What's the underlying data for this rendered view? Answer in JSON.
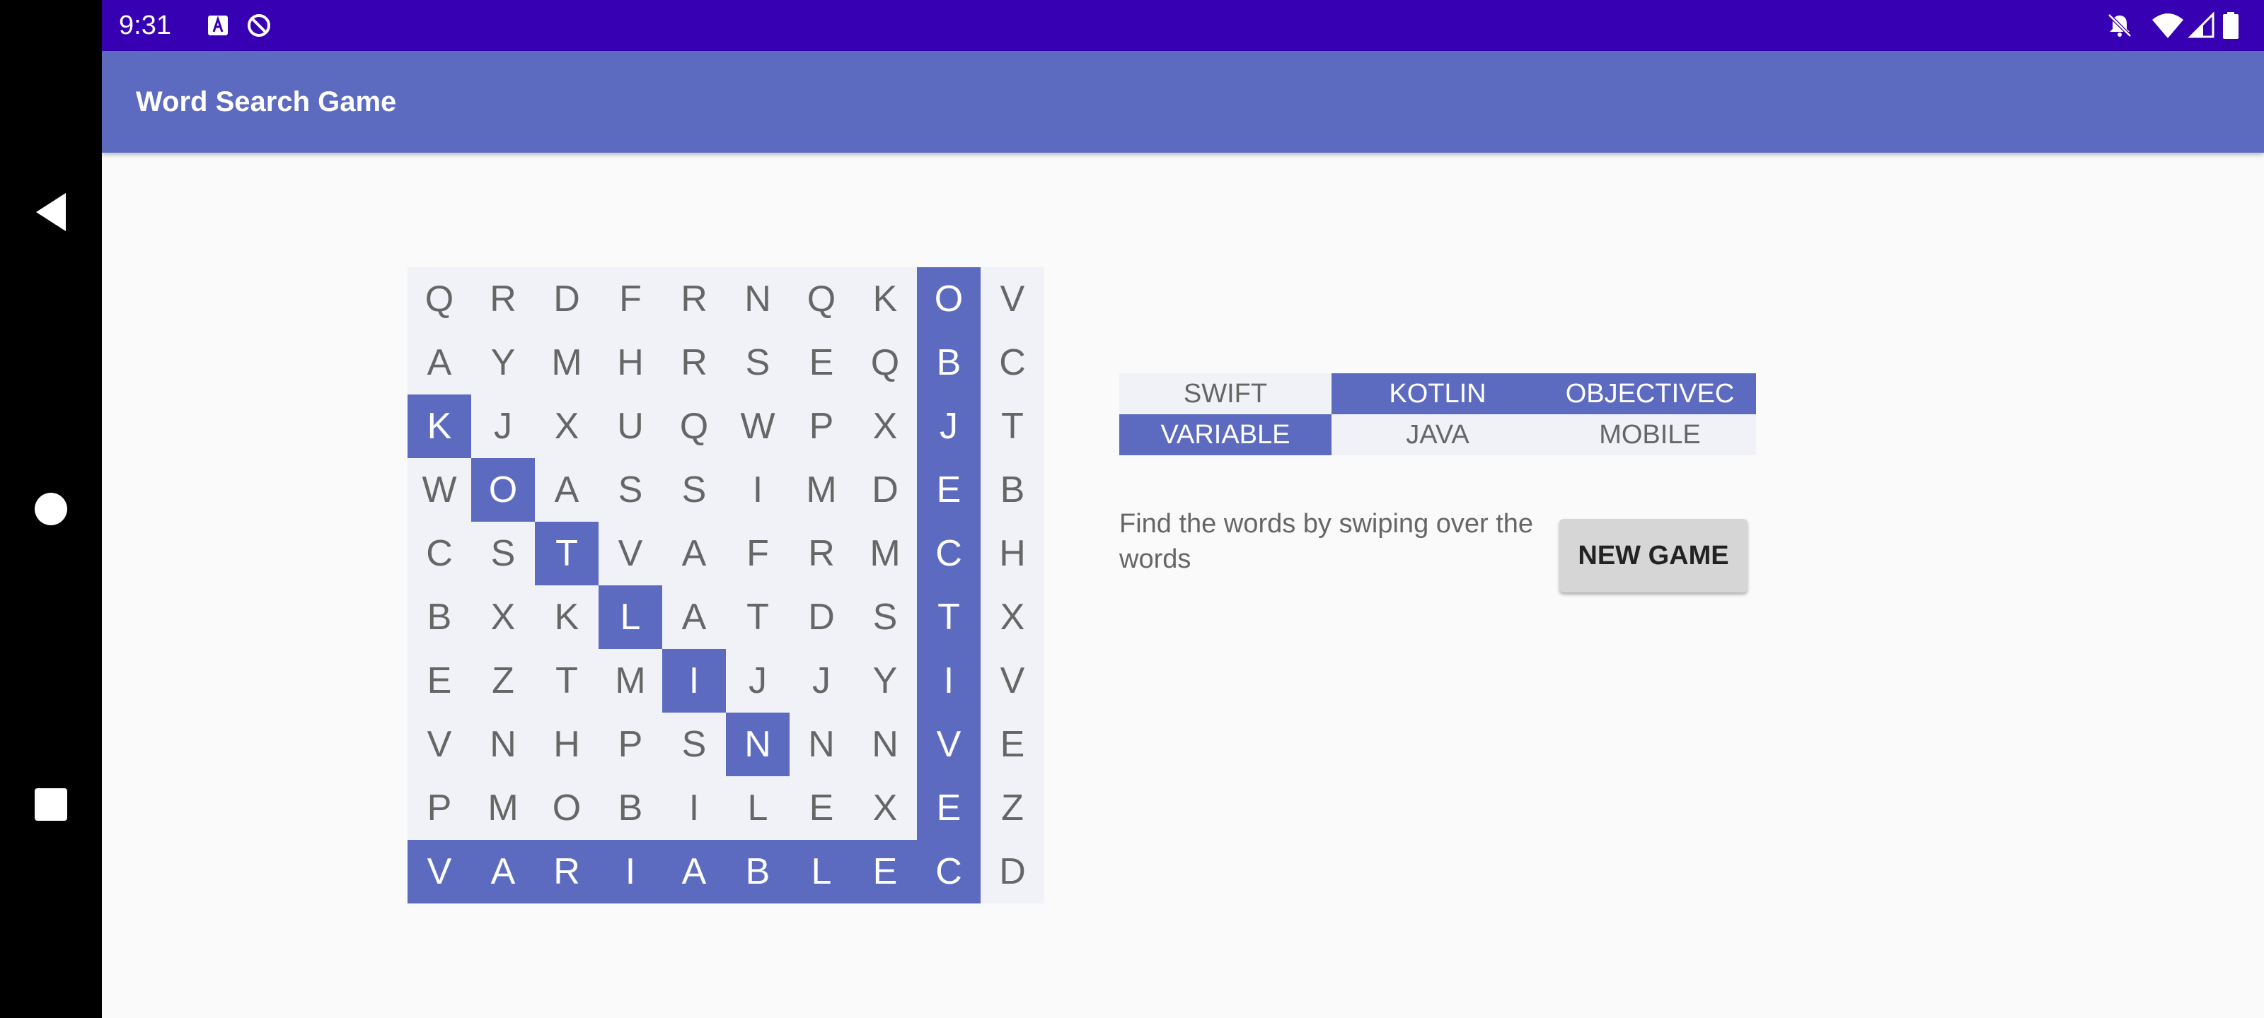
{
  "status_bar": {
    "time": "9:31"
  },
  "app_bar": {
    "title": "Word Search Game"
  },
  "grid": {
    "rows": [
      [
        "Q",
        "R",
        "D",
        "F",
        "R",
        "N",
        "Q",
        "K",
        "O",
        "V"
      ],
      [
        "A",
        "Y",
        "M",
        "H",
        "R",
        "S",
        "E",
        "Q",
        "B",
        "C"
      ],
      [
        "K",
        "J",
        "X",
        "U",
        "Q",
        "W",
        "P",
        "X",
        "J",
        "T"
      ],
      [
        "W",
        "O",
        "A",
        "S",
        "S",
        "I",
        "M",
        "D",
        "E",
        "B"
      ],
      [
        "C",
        "S",
        "T",
        "V",
        "A",
        "F",
        "R",
        "M",
        "C",
        "H"
      ],
      [
        "B",
        "X",
        "K",
        "L",
        "A",
        "T",
        "D",
        "S",
        "T",
        "X"
      ],
      [
        "E",
        "Z",
        "T",
        "M",
        "I",
        "J",
        "J",
        "Y",
        "I",
        "V"
      ],
      [
        "V",
        "N",
        "H",
        "P",
        "S",
        "N",
        "N",
        "N",
        "V",
        "E"
      ],
      [
        "P",
        "M",
        "O",
        "B",
        "I",
        "L",
        "E",
        "X",
        "E",
        "Z"
      ],
      [
        "V",
        "A",
        "R",
        "I",
        "A",
        "B",
        "L",
        "E",
        "C",
        "D"
      ]
    ],
    "highlighted": [
      [
        0,
        8
      ],
      [
        1,
        8
      ],
      [
        2,
        8
      ],
      [
        3,
        8
      ],
      [
        4,
        8
      ],
      [
        5,
        8
      ],
      [
        6,
        8
      ],
      [
        7,
        8
      ],
      [
        8,
        8
      ],
      [
        9,
        8
      ],
      [
        2,
        0
      ],
      [
        3,
        1
      ],
      [
        4,
        2
      ],
      [
        5,
        3
      ],
      [
        6,
        4
      ],
      [
        7,
        5
      ],
      [
        9,
        0
      ],
      [
        9,
        1
      ],
      [
        9,
        2
      ],
      [
        9,
        3
      ],
      [
        9,
        4
      ],
      [
        9,
        5
      ],
      [
        9,
        6
      ],
      [
        9,
        7
      ]
    ]
  },
  "words": [
    {
      "text": "SWIFT",
      "found": false
    },
    {
      "text": "KOTLIN",
      "found": true
    },
    {
      "text": "OBJECTIVEC",
      "found": true
    },
    {
      "text": "VARIABLE",
      "found": true
    },
    {
      "text": "JAVA",
      "found": false
    },
    {
      "text": "MOBILE",
      "found": false
    }
  ],
  "instructions": "Find the words by swiping over the words",
  "new_game_label": "NEW GAME",
  "colors": {
    "accent": "#5c6bc0",
    "status_bar": "#3700b3",
    "cell_bg": "#f1f2f8"
  }
}
